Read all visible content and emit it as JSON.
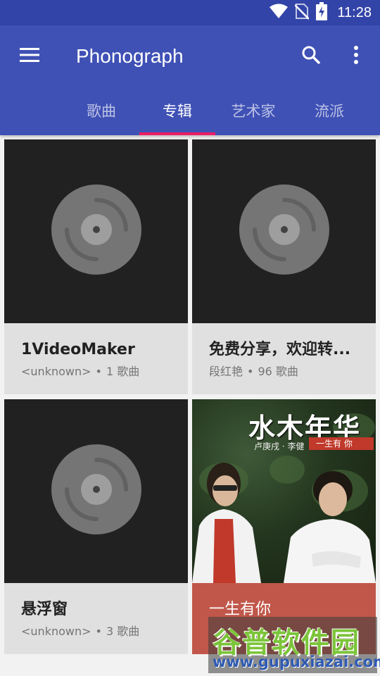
{
  "status_bar": {
    "time": "11:28",
    "icons": [
      "wifi-icon",
      "no-sim-icon",
      "battery-charging-icon"
    ]
  },
  "toolbar": {
    "menu_icon": "menu-icon",
    "title": "Phonograph",
    "search_icon": "search-icon",
    "more_icon": "more-vert-icon"
  },
  "tabs": [
    {
      "label": "歌曲",
      "active": false
    },
    {
      "label": "专辑",
      "active": true
    },
    {
      "label": "艺术家",
      "active": false
    },
    {
      "label": "流派",
      "active": false
    }
  ],
  "albums": [
    {
      "title": "1VideoMaker",
      "artist": "<unknown>",
      "separator": "•",
      "song_count": "1 歌曲",
      "art": "default-disc"
    },
    {
      "title": "免费分享，欢迎转...",
      "artist": "段红艳",
      "separator": "•",
      "song_count": "96 歌曲",
      "art": "default-disc"
    },
    {
      "title": "悬浮窗",
      "artist": "<unknown>",
      "separator": "•",
      "song_count": "3 歌曲",
      "art": "default-disc"
    },
    {
      "title": "一生有你",
      "art": "photo",
      "cover_text": {
        "title": "水木年华",
        "names": "卢庚戌 · 李健",
        "subtitle": "一生有  你"
      }
    }
  ],
  "watermark": {
    "text": "谷普软件园",
    "url": "www.gupuxiazai.com"
  },
  "colors": {
    "primary": "#3f51b5",
    "status_bar": "#3344a8",
    "accent": "#e91e63",
    "card_bg": "#e0e0e0",
    "art_bg": "#212121",
    "photo_footer": "#c0574a"
  }
}
